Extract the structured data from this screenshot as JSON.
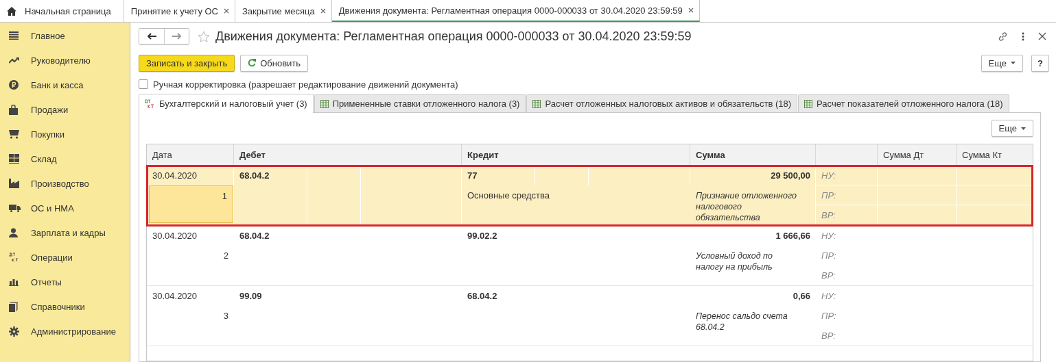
{
  "top_tabs": [
    {
      "label": "Начальная страница",
      "kind": "home",
      "selected": false
    },
    {
      "label": "Принятие к учету ОС",
      "kind": "closable",
      "selected": false
    },
    {
      "label": "Закрытие месяца",
      "kind": "closable",
      "selected": false
    },
    {
      "label": "Движения документа: Регламентная операция 0000-000033 от 30.04.2020 23:59:59",
      "kind": "closable",
      "selected": true
    }
  ],
  "sidebar": {
    "items": [
      {
        "label": "Главное",
        "kind": "menu"
      },
      {
        "label": "Руководителю",
        "kind": "trend"
      },
      {
        "label": "Банк и касса",
        "kind": "ruble"
      },
      {
        "label": "Продажи",
        "kind": "bag"
      },
      {
        "label": "Покупки",
        "kind": "cart"
      },
      {
        "label": "Склад",
        "kind": "grid"
      },
      {
        "label": "Производство",
        "kind": "factory"
      },
      {
        "label": "ОС и НМА",
        "kind": "truck"
      },
      {
        "label": "Зарплата и кадры",
        "kind": "person"
      },
      {
        "label": "Операции",
        "kind": "dtkt"
      },
      {
        "label": "Отчеты",
        "kind": "bars"
      },
      {
        "label": "Справочники",
        "kind": "books"
      },
      {
        "label": "Администрирование",
        "kind": "gear"
      }
    ]
  },
  "form": {
    "title": "Движения документа: Регламентная операция 0000-000033 от 30.04.2020 23:59:59",
    "save_button": "Записать и закрыть",
    "refresh_button": "Обновить",
    "more_button": "Еще",
    "help_button": "?",
    "manual_edit": {
      "label": "Ручная корректировка (разрешает редактирование движений документа)",
      "checked": false
    },
    "tabs": [
      {
        "label": "Бухгалтерский и налоговый учет (3)",
        "kind": "dtkt",
        "selected": true
      },
      {
        "label": "Примененные ставки отложенного налога (3)",
        "kind": "table",
        "selected": false
      },
      {
        "label": "Расчет отложенных налоговых активов и обязательств (18)",
        "kind": "table",
        "selected": false
      },
      {
        "label": "Расчет показателей отложенного налога (18)",
        "kind": "table",
        "selected": false
      }
    ],
    "panel_more_button": "Еще"
  },
  "table": {
    "columns": [
      "Дата",
      "Дебет",
      "Кредит",
      "Сумма",
      "Сумма Дт",
      "Сумма Кт"
    ],
    "rows": [
      {
        "date": "30.04.2020",
        "number": "1",
        "debit": "68.04.2",
        "credit": "77",
        "credit_subconto": "Основные средства",
        "amount": "29 500,00",
        "comment": "Признание отложенного налогового обязательства",
        "labels": [
          "НУ:",
          "ПР:",
          "ВР:"
        ],
        "selected": true
      },
      {
        "date": "30.04.2020",
        "number": "2",
        "debit": "68.04.2",
        "credit": "99.02.2",
        "amount": "1 666,66",
        "comment": "Условный доход по налогу на прибыль",
        "labels": [
          "НУ:",
          "ПР:",
          "ВР:"
        ],
        "selected": false
      },
      {
        "date": "30.04.2020",
        "number": "3",
        "debit": "99.09",
        "credit": "68.04.2",
        "amount": "0,66",
        "comment": "Перенос сальдо счета 68.04.2",
        "labels": [
          "НУ:",
          "ПР:",
          "ВР:"
        ],
        "selected": false
      }
    ]
  }
}
